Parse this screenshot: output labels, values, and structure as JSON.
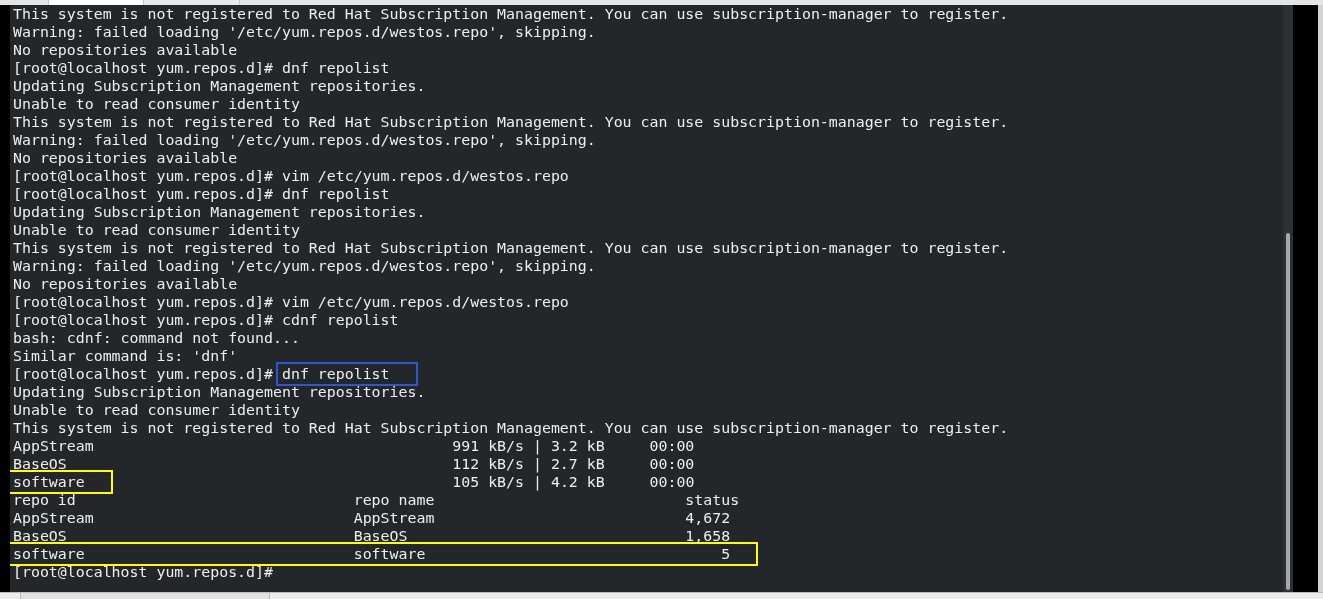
{
  "terminal": {
    "lines": [
      {
        "text": "This system is not registered to Red Hat Subscription Management. You can use subscription-manager to register."
      },
      {
        "text": "Warning: failed loading '/etc/yum.repos.d/westos.repo', skipping."
      },
      {
        "text": "No repositories available"
      },
      {
        "text": "[root@localhost yum.repos.d]# dnf repolist"
      },
      {
        "text": "Updating Subscription Management repositories."
      },
      {
        "text": "Unable to read consumer identity"
      },
      {
        "text": "This system is not registered to Red Hat Subscription Management. You can use subscription-manager to register."
      },
      {
        "text": "Warning: failed loading '/etc/yum.repos.d/westos.repo', skipping."
      },
      {
        "text": "No repositories available"
      },
      {
        "text": "[root@localhost yum.repos.d]# vim /etc/yum.repos.d/westos.repo"
      },
      {
        "text": "[root@localhost yum.repos.d]# dnf repolist"
      },
      {
        "text": "Updating Subscription Management repositories."
      },
      {
        "text": "Unable to read consumer identity"
      },
      {
        "text": "This system is not registered to Red Hat Subscription Management. You can use subscription-manager to register."
      },
      {
        "text": "Warning: failed loading '/etc/yum.repos.d/westos.repo', skipping."
      },
      {
        "text": "No repositories available"
      },
      {
        "text": "[root@localhost yum.repos.d]# vim /etc/yum.repos.d/westos.repo"
      },
      {
        "text": "[root@localhost yum.repos.d]# cdnf repolist"
      },
      {
        "text": "bash: cdnf: command not found..."
      },
      {
        "text": "Similar command is: 'dnf'"
      },
      {
        "segments": [
          {
            "text": "[root@localhost yum.repos.d]# "
          },
          {
            "text": "dnf repolist",
            "color": "#2e55d6"
          }
        ]
      },
      {
        "text": "Updating Subscription Management repositories."
      },
      {
        "text": "Unable to read consumer identity"
      },
      {
        "text": "This system is not registered to Red Hat Subscription Management. You can use subscription-manager to register."
      },
      {
        "text": "AppStream                                        991 kB/s | 3.2 kB     00:00"
      },
      {
        "text": "BaseOS                                           112 kB/s | 2.7 kB     00:00"
      },
      {
        "segments": [
          {
            "text": "software",
            "color": "#ffff00"
          },
          {
            "text": "                                         105 kB/s | 4.2 kB     00:00"
          }
        ]
      },
      {
        "text": "repo id                               repo name                            status"
      },
      {
        "text": "AppStream                             AppStream                            4,672"
      },
      {
        "text": "BaseOS                                BaseOS                               1,658"
      },
      {
        "segments": [
          {
            "text": "software                              software                                 5",
            "color": "#ffff00"
          }
        ]
      },
      {
        "text": "[root@localhost yum.repos.d]#"
      }
    ]
  }
}
